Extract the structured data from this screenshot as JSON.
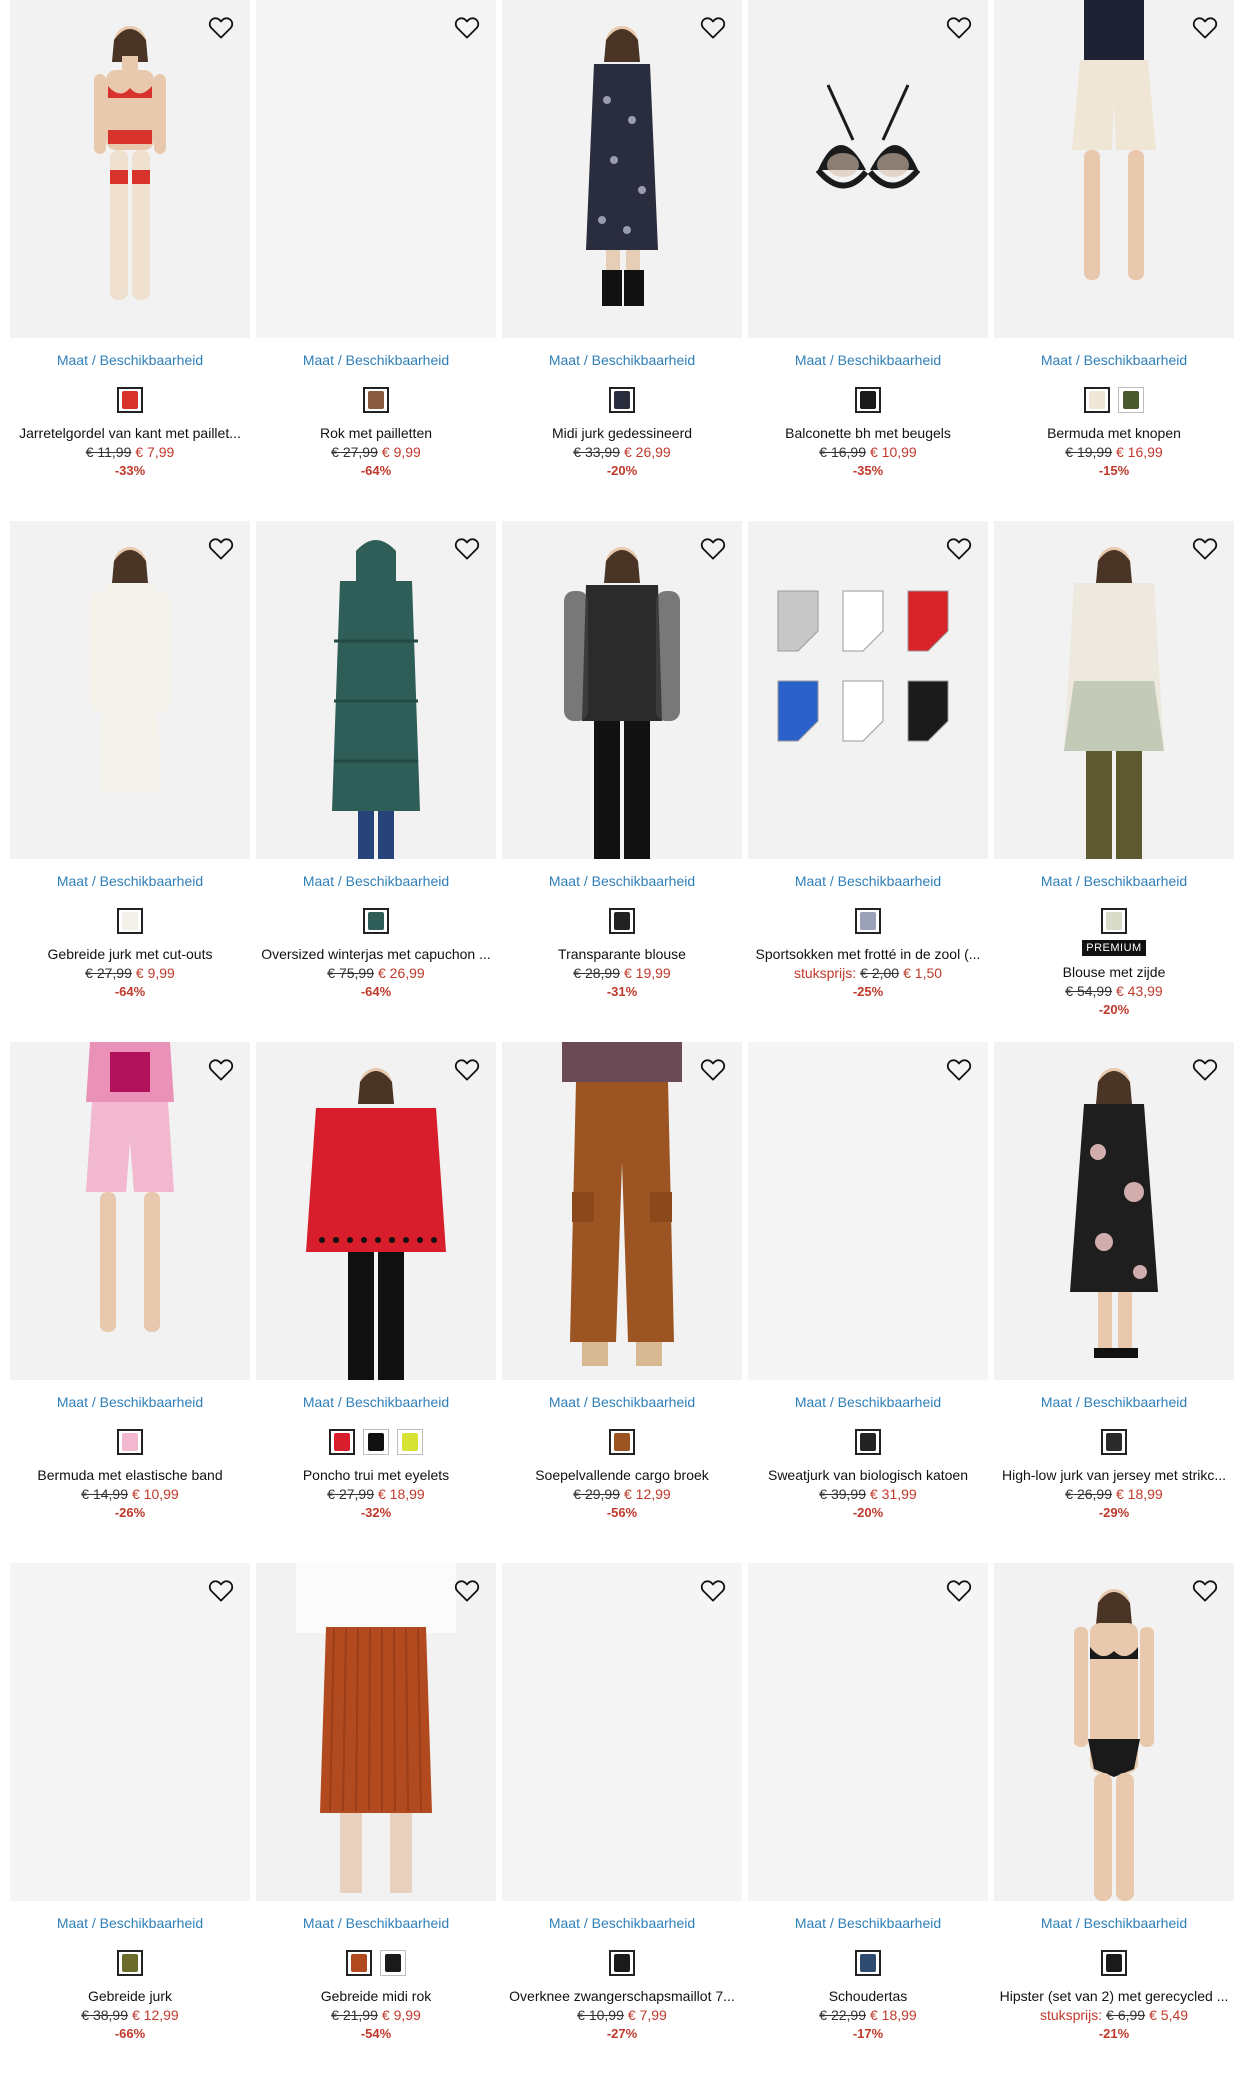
{
  "common": {
    "size_link": "Maat / Beschikbaarheid"
  },
  "colors": {
    "price_red": "#c0392b",
    "link_blue": "#2f7fb9"
  },
  "products": [
    {
      "name": "Jarretelgordel van kant met paillet...",
      "old": "€ 11,99",
      "new": "€ 7,99",
      "discount": "-33%",
      "image": "lingerie-model-red",
      "swatches": [
        "#d8322d"
      ]
    },
    {
      "name": "Rok met pailletten",
      "old": "€ 27,99",
      "new": "€ 9,99",
      "discount": "-64%",
      "image": "blank",
      "swatches": [
        "#8a5a3c"
      ]
    },
    {
      "name": "Midi jurk gedessineerd",
      "old": "€ 33,99",
      "new": "€ 26,99",
      "discount": "-20%",
      "image": "floral-dress-back",
      "swatches": [
        "#2a2d3e"
      ]
    },
    {
      "name": "Balconette bh met beugels",
      "old": "€ 16,99",
      "new": "€ 10,99",
      "discount": "-35%",
      "image": "black-lace-bra",
      "swatches": [
        "#1a1a1a"
      ]
    },
    {
      "name": "Bermuda met knopen",
      "old": "€ 19,99",
      "new": "€ 16,99",
      "discount": "-15%",
      "image": "beige-shorts",
      "swatches": [
        "#efe6d6",
        "#4b5a2e"
      ]
    },
    {
      "name": "Gebreide jurk met cut-outs",
      "old": "€ 27,99",
      "new": "€ 9,99",
      "discount": "-64%",
      "image": "white-knit-dress",
      "swatches": [
        "#f4f1ea"
      ]
    },
    {
      "name": "Oversized winterjas met capuchon ...",
      "old": "€ 75,99",
      "new": "€ 26,99",
      "discount": "-64%",
      "image": "green-winter-coat",
      "swatches": [
        "#2f5e58"
      ]
    },
    {
      "name": "Transparante blouse",
      "old": "€ 28,99",
      "new": "€ 19,99",
      "discount": "-31%",
      "image": "sheer-black-blouse",
      "swatches": [
        "#222222"
      ]
    },
    {
      "name": "Sportsokken met frotté in de zool (...",
      "unit": "stuksprijs:",
      "old": "€ 2,00",
      "new": "€ 1,50",
      "discount": "-25%",
      "image": "sport-socks",
      "swatches": [
        "#9aa0b6"
      ]
    },
    {
      "name": "Blouse met zijde",
      "badge": "PREMIUM",
      "old": "€ 54,99",
      "new": "€ 43,99",
      "discount": "-20%",
      "image": "silk-blouse",
      "swatches": [
        "#d9dcc8"
      ]
    },
    {
      "name": "Bermuda met elastische band",
      "old": "€ 14,99",
      "new": "€ 10,99",
      "discount": "-26%",
      "image": "pink-shorts",
      "swatches": [
        "#f2b8cf"
      ]
    },
    {
      "name": "Poncho trui met eyelets",
      "old": "€ 27,99",
      "new": "€ 18,99",
      "discount": "-32%",
      "image": "red-poncho",
      "swatches": [
        "#d81e2c",
        "#111111",
        "#d6e234"
      ]
    },
    {
      "name": "Soepelvallende cargo broek",
      "old": "€ 29,99",
      "new": "€ 12,99",
      "discount": "-56%",
      "image": "brown-cargo-pants",
      "swatches": [
        "#9c5422"
      ]
    },
    {
      "name": "Sweatjurk van biologisch katoen",
      "old": "€ 39,99",
      "new": "€ 31,99",
      "discount": "-20%",
      "image": "blank",
      "swatches": [
        "#222222"
      ]
    },
    {
      "name": "High-low jurk van jersey met strikc...",
      "old": "€ 26,99",
      "new": "€ 18,99",
      "discount": "-29%",
      "image": "floral-wrap-dress",
      "swatches": [
        "#2a2a2a"
      ]
    },
    {
      "name": "Gebreide jurk",
      "old": "€ 38,99",
      "new": "€ 12,99",
      "discount": "-66%",
      "image": "blank",
      "swatches": [
        "#6b6b2a"
      ]
    },
    {
      "name": "Gebreide midi rok",
      "old": "€ 21,99",
      "new": "€ 9,99",
      "discount": "-54%",
      "image": "rust-midi-skirt",
      "swatches": [
        "#b24a1f",
        "#1a1a1a"
      ]
    },
    {
      "name": "Overknee zwangerschapsmaillot 7...",
      "old": "€ 10,99",
      "new": "€ 7,99",
      "discount": "-27%",
      "image": "blank",
      "swatches": [
        "#1a1a1a"
      ]
    },
    {
      "name": "Schoudertas",
      "old": "€ 22,99",
      "new": "€ 18,99",
      "discount": "-17%",
      "image": "blank",
      "swatches": [
        "#2e4a6e"
      ]
    },
    {
      "name": "Hipster (set van 2) met gerecycled ...",
      "unit": "stuksprijs:",
      "old": "€ 6,99",
      "new": "€ 5,49",
      "discount": "-21%",
      "image": "black-hipster-model",
      "swatches": [
        "#1a1a1a"
      ]
    }
  ]
}
